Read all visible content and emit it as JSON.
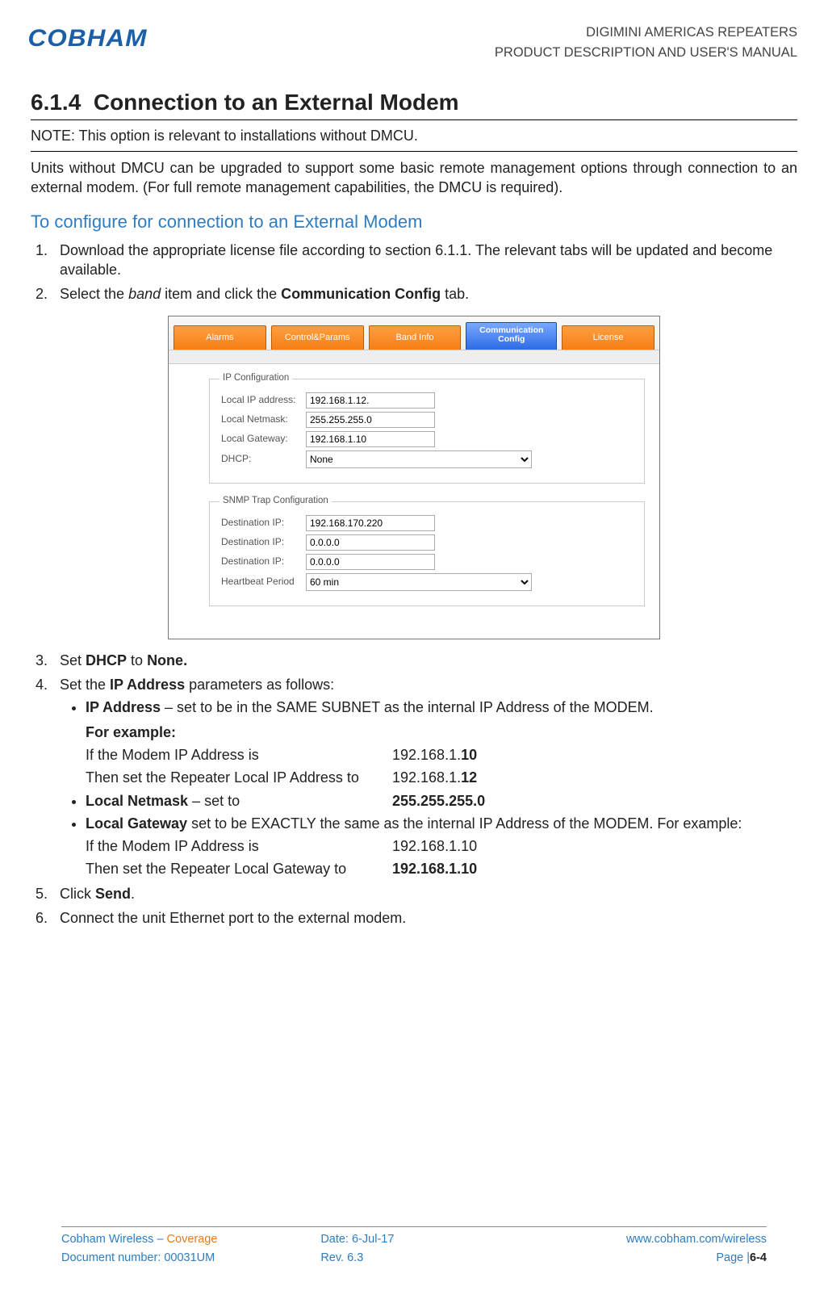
{
  "header": {
    "logo": "COBHAM",
    "line1": "DIGIMINI AMERICAS REPEATERS",
    "line2": "PRODUCT DESCRIPTION AND USER'S MANUAL"
  },
  "section": {
    "number": "6.1.4",
    "title": "Connection to an External Modem"
  },
  "note": "NOTE: This option is relevant to installations without DMCU.",
  "para1": "Units without DMCU can be upgraded to support some basic remote management options through connection to an external modem. (For full remote management capabilities, the DMCU is required).",
  "subhead": "To configure for connection to an External Modem",
  "steps": {
    "s1": "Download the appropriate license file according to section 6.1.1. The relevant tabs will be updated and become available.",
    "s2_a": "Select the ",
    "s2_b": "band",
    "s2_c": " item and click the ",
    "s2_d": "Communication Config",
    "s2_e": " tab.",
    "s3_a": "Set ",
    "s3_b": "DHCP",
    "s3_c": " to ",
    "s3_d": "None.",
    "s4_a": "Set the ",
    "s4_b": "IP Address",
    "s4_c": " parameters as follows:",
    "s5_a": "Click ",
    "s5_b": "Send",
    "s5_c": ".",
    "s6": "Connect the unit Ethernet port to the external modem."
  },
  "bullets": {
    "b1_a": "IP Address",
    "b1_b": " – set to be in the SAME SUBNET as the internal IP Address of the MODEM.",
    "b1_for": "For example:",
    "b1_r1a": "If the Modem IP Address is",
    "b1_r1b_pre": "192.168.1.",
    "b1_r1b_bold": "10",
    "b1_r2a": "Then set the Repeater Local IP Address to",
    "b1_r2b_pre": "192.168.1.",
    "b1_r2b_bold": "12",
    "b2_a": "Local Netmask",
    "b2_b": " – set to",
    "b2_v": "255.255.255.0",
    "b3_a": "Local Gateway",
    "b3_b": " set to be EXACTLY the same as the internal IP Address of the MODEM. For example:",
    "b3_r1a": "If the Modem IP Address is",
    "b3_r1b": "192.168.1.10",
    "b3_r2a": "Then set the Repeater Local Gateway to",
    "b3_r2b": "192.168.1.10"
  },
  "screenshot": {
    "tabs": {
      "t1": "Alarms",
      "t2": "Control&Params",
      "t3": "Band Info",
      "t4": "Communication Config",
      "t5": "License"
    },
    "ip_config": {
      "legend": "IP Configuration",
      "local_ip_label": "Local IP address:",
      "local_ip_value": "192.168.1.12.",
      "netmask_label": "Local Netmask:",
      "netmask_value": "255.255.255.0",
      "gateway_label": "Local Gateway:",
      "gateway_value": "192.168.1.10",
      "dhcp_label": "DHCP:",
      "dhcp_value": "None"
    },
    "snmp": {
      "legend": "SNMP Trap Configuration",
      "dest1_label": "Destination IP:",
      "dest1_value": "192.168.170.220",
      "dest2_label": "Destination IP:",
      "dest2_value": "0.0.0.0",
      "dest3_label": "Destination IP:",
      "dest3_value": "0.0.0.0",
      "hb_label": "Heartbeat Period",
      "hb_value": "60 min"
    }
  },
  "footer": {
    "l1a": "Cobham Wireless",
    "l1b": " – ",
    "l1c": "Coverage",
    "c1": "Date: 6-Jul-17",
    "r1": "www.cobham.com/wireless",
    "l2": "Document number: 00031UM",
    "c2": "Rev. 6.3",
    "r2a": "Page |",
    "r2b": "6-4"
  }
}
